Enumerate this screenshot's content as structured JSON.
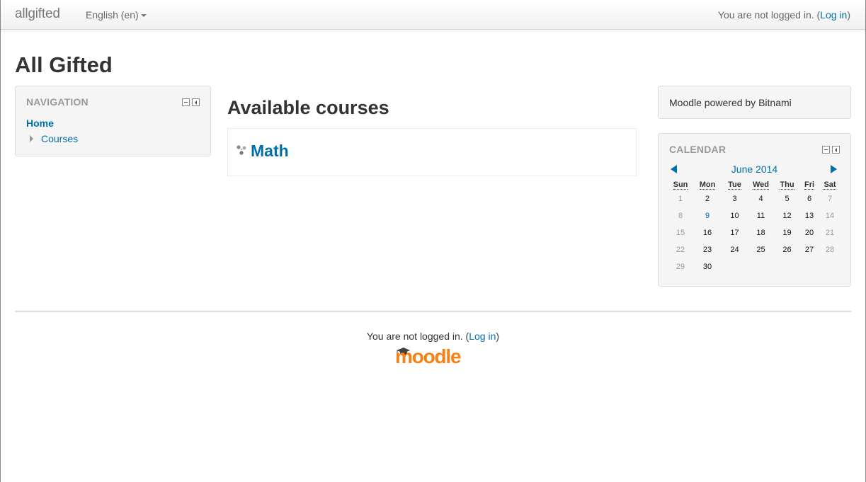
{
  "navbar": {
    "brand": "allgifted",
    "language": "English (en)",
    "login_text": "You are not logged in. (",
    "login_link": "Log in",
    "login_close": ")"
  },
  "page": {
    "title": "All Gifted"
  },
  "navigation": {
    "title": "NAVIGATION",
    "home": "Home",
    "courses": "Courses"
  },
  "main": {
    "heading": "Available courses",
    "courses": [
      {
        "name": "Math"
      }
    ]
  },
  "bitnami": {
    "text": "Moodle powered by Bitnami"
  },
  "calendar": {
    "title": "CALENDAR",
    "month": "June 2014",
    "weekdays": [
      "Sun",
      "Mon",
      "Tue",
      "Wed",
      "Thu",
      "Fri",
      "Sat"
    ],
    "weeks": [
      [
        "1",
        "2",
        "3",
        "4",
        "5",
        "6",
        "7"
      ],
      [
        "8",
        "9",
        "10",
        "11",
        "12",
        "13",
        "14"
      ],
      [
        "15",
        "16",
        "17",
        "18",
        "19",
        "20",
        "21"
      ],
      [
        "22",
        "23",
        "24",
        "25",
        "26",
        "27",
        "28"
      ],
      [
        "29",
        "30",
        "",
        "",
        "",
        "",
        ""
      ]
    ],
    "today": "9"
  },
  "footer": {
    "login_text": "You are not logged in. (",
    "login_link": "Log in",
    "login_close": ")",
    "logo_text": "moodle"
  },
  "colors": {
    "link": "#0070a8",
    "moodle_orange": "#f98012",
    "block_bg": "#f5f5f5"
  },
  "icons": {
    "course_icon": "course-category-icon",
    "logo_hat": "graduation-cap-icon"
  }
}
